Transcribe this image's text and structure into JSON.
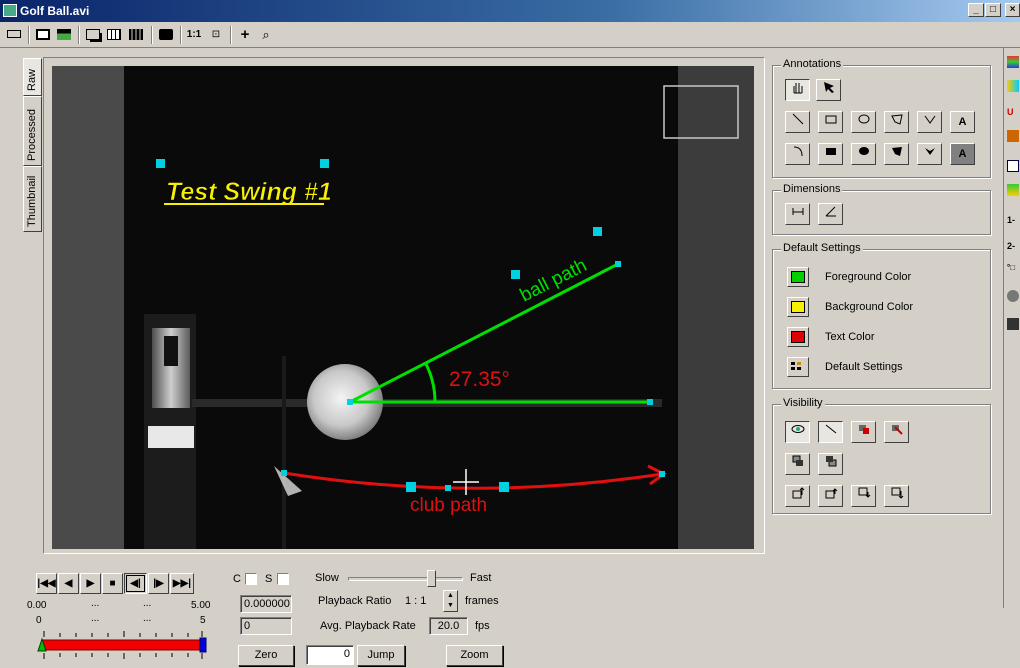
{
  "window": {
    "title": "Golf Ball.avi",
    "min": "_",
    "max": "□",
    "close": "×"
  },
  "toolbar": {
    "zoom_1to1": "1:1",
    "fit": "⊡",
    "crosshair": "+",
    "magnifier": "⌕"
  },
  "tabs": [
    {
      "label": "Raw"
    },
    {
      "label": "Processed"
    },
    {
      "label": "Thumbnail"
    }
  ],
  "annotations_on_video": {
    "title_text": "Test Swing #1",
    "ball_path_label": "ball path",
    "angle_label": "27.35°",
    "club_path_label": "club path",
    "colors": {
      "ball_path": "#00e000",
      "angle": "#e01010",
      "club_path": "#e01010",
      "title_text": "#f8f000",
      "handles": "#00d0e0"
    }
  },
  "panel": {
    "annotations": {
      "title": "Annotations",
      "text_tool": "A",
      "filled_text_tool": "A"
    },
    "dimensions": {
      "title": "Dimensions"
    },
    "default_settings": {
      "title": "Default Settings",
      "items": [
        {
          "label": "Foreground Color",
          "color": "#00d000"
        },
        {
          "label": "Background Color",
          "color": "#f8f000"
        },
        {
          "label": "Text Color",
          "color": "#e00000"
        },
        {
          "label": "Default Settings"
        }
      ]
    },
    "visibility": {
      "title": "Visibility"
    }
  },
  "right_strip": {
    "label_1": "1-",
    "label_2": "2-"
  },
  "playback": {
    "time_start": "0.00",
    "time_dots_1": "...",
    "time_dots_2": "...",
    "time_end": "5.00",
    "frame_start": "0",
    "frame_dots_1": "...",
    "frame_dots_2": "...",
    "frame_end": "5",
    "c_label": "C",
    "s_label": "S",
    "time_value": "0.000000",
    "frame_value": "0",
    "zero_button": "Zero",
    "jump_value": "0",
    "jump_button": "Jump",
    "speed_slow": "Slow",
    "speed_fast": "Fast",
    "speed_position": 0.72,
    "playback_ratio_label": "Playback Ratio",
    "playback_ratio_value": "1 : 1",
    "frames_label": "frames",
    "avg_rate_label": "Avg. Playback Rate",
    "avg_rate_value": "20.0",
    "fps_label": "fps",
    "zoom_button": "Zoom"
  }
}
